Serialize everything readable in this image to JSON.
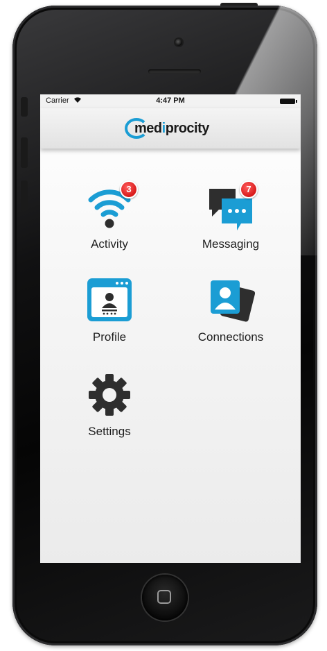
{
  "status_bar": {
    "carrier": "Carrier",
    "time": "4:47 PM"
  },
  "header": {
    "logo_prefix": "med",
    "logo_accent": "i",
    "logo_suffix": "procity"
  },
  "tiles": [
    {
      "label": "Activity",
      "icon": "wifi-signal-icon",
      "badge": "3"
    },
    {
      "label": "Messaging",
      "icon": "chat-bubbles-icon",
      "badge": "7"
    },
    {
      "label": "Profile",
      "icon": "profile-card-icon",
      "badge": null
    },
    {
      "label": "Connections",
      "icon": "contacts-cards-icon",
      "badge": null
    },
    {
      "label": "Settings",
      "icon": "gear-icon",
      "badge": null
    }
  ],
  "colors": {
    "brand_blue": "#1b9dd4",
    "badge_red": "#d81a1a",
    "icon_dark": "#2e2e2e"
  }
}
